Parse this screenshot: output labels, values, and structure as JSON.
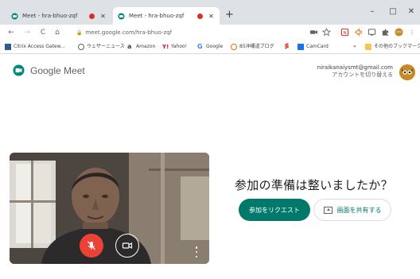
{
  "browser": {
    "tabs": [
      {
        "title": "Meet - hra-bhuo-zqf",
        "recording": true,
        "close": "✕",
        "active": false
      },
      {
        "title": "Meet - hra-bhuo-zqf",
        "recording": true,
        "close": "✕",
        "active": true
      }
    ],
    "new_tab": "+",
    "window_controls": {
      "minimize": "–",
      "maximize": "□",
      "close": "✕"
    },
    "nav": {
      "back": "←",
      "forward": "→",
      "reload": "C",
      "home": "⌂"
    },
    "url": "meet.google.com/hra-bhuo-zqf",
    "bookmarks": [
      {
        "label": "Citrix Access Gatew...",
        "icon": "citrix-icon",
        "color": "#2d5d8b"
      },
      {
        "label": "ウェザーニュース",
        "icon": "weather-icon",
        "color": "#5f6368"
      },
      {
        "label": "Amazon",
        "icon": "amazon-icon",
        "color": "#111111"
      },
      {
        "label": "Yahoo!",
        "icon": "yahoo-icon",
        "color": "#e00034"
      },
      {
        "label": "Google",
        "icon": "google-icon",
        "color": "#4285f4"
      },
      {
        "label": "85沖縄道ブログ",
        "icon": "blog-icon",
        "color": "#e8710a"
      },
      {
        "label": "",
        "icon": "mf-icon",
        "color": "#d93025"
      },
      {
        "label": "CamCard",
        "icon": "camcard-icon",
        "color": "#1a73e8"
      },
      {
        "label": "その他のブックマーク",
        "icon": "folder-icon",
        "color": "#f2c94c"
      }
    ],
    "bookmarks_more": "»"
  },
  "meet": {
    "brand": "Google Meet",
    "account_email": "niraikanaiysmt@gmail.com",
    "account_switch": "アカウントを切り替える",
    "ready_text": "参加の準備は整いましたか？",
    "join_button": "参加をリクエスト",
    "present_button": "画面を共有する",
    "mic_muted": true
  },
  "colors": {
    "accent": "#00796b",
    "mic_off": "#ea4335",
    "tab_strip": "#dee1e6"
  }
}
